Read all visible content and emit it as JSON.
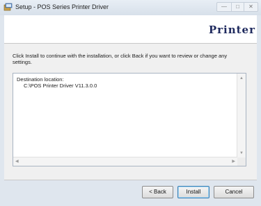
{
  "window": {
    "title": "Setup - POS Series Printer Driver"
  },
  "header": {
    "brand": "Printer"
  },
  "main": {
    "instructions": "Click Install to continue with the installation, or click Back if you want to review or change any settings.",
    "destination_label": "Destination location:",
    "destination_value": "C:\\POS Printer Driver V11.3.0.0"
  },
  "buttons": {
    "back": "< Back",
    "install": "Install",
    "cancel": "Cancel"
  },
  "icons": {
    "app": "setup-installer-icon",
    "minimize": "minimize-icon",
    "maximize": "maximize-icon",
    "close": "close-icon",
    "scroll_up": "arrow-up-icon",
    "scroll_down": "arrow-down-icon",
    "scroll_left": "arrow-left-icon",
    "scroll_right": "arrow-right-icon"
  },
  "colors": {
    "brand": "#1f2a5e",
    "default_button_border": "#3c7fb1"
  }
}
